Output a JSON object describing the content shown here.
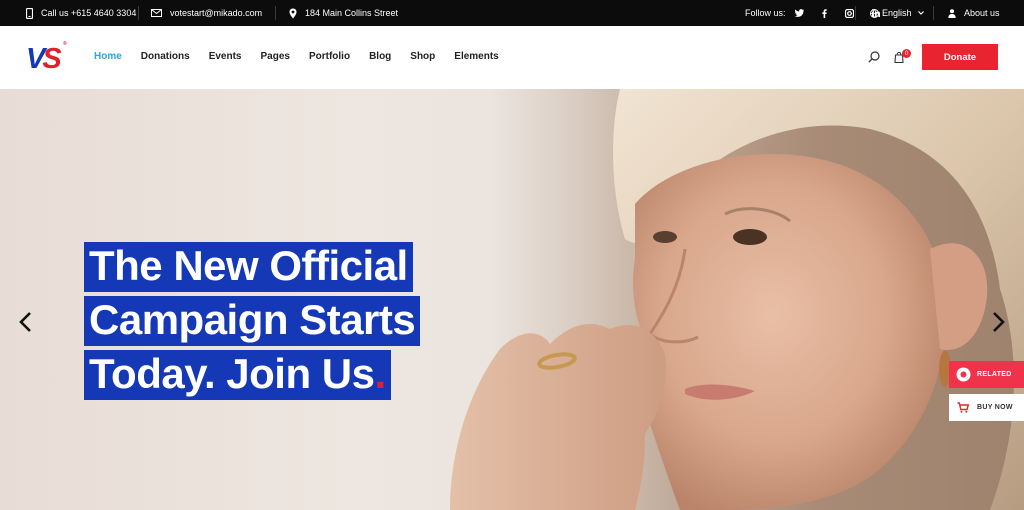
{
  "topbar": {
    "phone": "Call us +615 4640 3304",
    "email": "votestart@mikado.com",
    "address": "184 Main Collins Street",
    "follow_label": "Follow us:",
    "language": "English",
    "about": "About us",
    "icons": [
      "phone-icon",
      "mail-icon",
      "location-pin-icon",
      "twitter-icon",
      "facebook-icon",
      "instagram-icon",
      "linkedin-icon",
      "globe-icon",
      "chevron-down-icon",
      "user-icon"
    ]
  },
  "header": {
    "logo": {
      "v": "V",
      "s": "S"
    },
    "nav": [
      "Home",
      "Donations",
      "Events",
      "Pages",
      "Portfolio",
      "Blog",
      "Shop",
      "Elements"
    ],
    "active_nav": "Home",
    "cart_count": "0",
    "donate_label": "Donate",
    "colors": {
      "brand_blue": "#1539b6",
      "brand_red": "#e2202d",
      "active_link": "#29a8df",
      "donate_bg": "#e82430"
    }
  },
  "hero": {
    "headline": [
      "The New Official",
      "Campaign Starts",
      "Today. Join Us"
    ],
    "headline_end": ".",
    "prev_icon": "chevron-left-icon",
    "next_icon": "chevron-right-icon"
  },
  "side_buttons": {
    "related": "RELATED",
    "buy_now": "BUY NOW"
  }
}
